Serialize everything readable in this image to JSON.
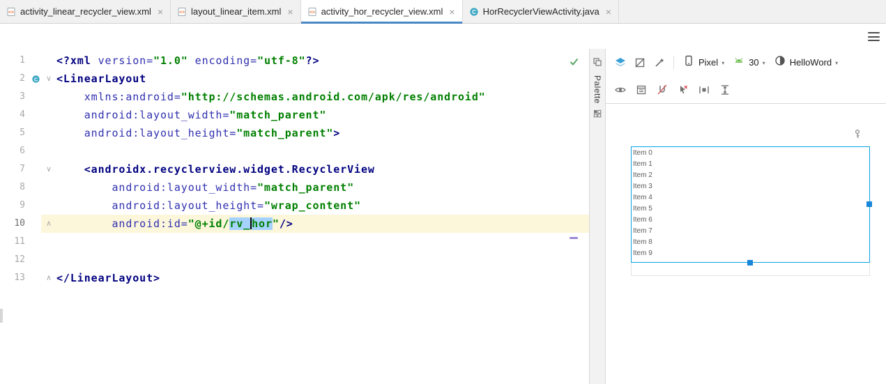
{
  "colors": {
    "tab_underline": "#4A88C5",
    "tag": "#000080",
    "attribute": "#3030B0",
    "value": "#008000",
    "current_line_bg": "#FCF6DB",
    "selection_bg": "#A6D2FF",
    "selection_border": "#0BA1E2",
    "handle": "#1887D9",
    "check_green": "#59A869",
    "android_green": "#77C157",
    "design_icon_blue": "#389FD6"
  },
  "tab_bar": {
    "tabs": [
      {
        "label": "activity_linear_recycler_view.xml",
        "icon": "xml-file-icon",
        "active": false,
        "close": "×"
      },
      {
        "label": "layout_linear_item.xml",
        "icon": "xml-file-icon",
        "active": false,
        "close": "×"
      },
      {
        "label": "activity_hor_recycler_view.xml",
        "icon": "xml-file-icon",
        "active": true,
        "close": "×"
      },
      {
        "label": "HorRecyclerViewActivity.java",
        "icon": "java-class-icon",
        "active": false,
        "close": "×"
      }
    ]
  },
  "navbar": {
    "menu_icon": "hamburger-menu-icon"
  },
  "editor": {
    "inspection_icon": "inspections-ok-icon",
    "lines": [
      {
        "num": 1,
        "fold": "",
        "gutter": "",
        "current": false,
        "tokens": [
          [
            "tag",
            "<?xml "
          ],
          [
            "attr",
            "version="
          ],
          [
            "str",
            "\"1.0\""
          ],
          [
            "plain",
            " "
          ],
          [
            "attr",
            "encoding="
          ],
          [
            "str",
            "\"utf-8\""
          ],
          [
            "tag",
            "?>"
          ]
        ]
      },
      {
        "num": 2,
        "fold": "down",
        "gutter": "class-circle-icon",
        "current": false,
        "tokens": [
          [
            "tag",
            "<LinearLayout"
          ]
        ]
      },
      {
        "num": 3,
        "fold": "",
        "gutter": "",
        "current": false,
        "tokens": [
          [
            "plain",
            "    "
          ],
          [
            "attr",
            "xmlns:android="
          ],
          [
            "str",
            "\"http://schemas.android.com/apk/res/android\""
          ]
        ]
      },
      {
        "num": 4,
        "fold": "",
        "gutter": "",
        "current": false,
        "tokens": [
          [
            "plain",
            "    "
          ],
          [
            "attr",
            "android:layout_width="
          ],
          [
            "str",
            "\"match_parent\""
          ]
        ]
      },
      {
        "num": 5,
        "fold": "",
        "gutter": "",
        "current": false,
        "tokens": [
          [
            "plain",
            "    "
          ],
          [
            "attr",
            "android:layout_height="
          ],
          [
            "str",
            "\"match_parent\""
          ],
          [
            "tag",
            ">"
          ]
        ]
      },
      {
        "num": 6,
        "fold": "",
        "gutter": "",
        "current": false,
        "tokens": []
      },
      {
        "num": 7,
        "fold": "down",
        "gutter": "",
        "current": false,
        "tokens": [
          [
            "plain",
            "    "
          ],
          [
            "tag",
            "<androidx.recyclerview.widget.RecyclerView"
          ]
        ]
      },
      {
        "num": 8,
        "fold": "",
        "gutter": "",
        "current": false,
        "tokens": [
          [
            "plain",
            "        "
          ],
          [
            "attr",
            "android:layout_width="
          ],
          [
            "str",
            "\"match_parent\""
          ]
        ]
      },
      {
        "num": 9,
        "fold": "",
        "gutter": "",
        "current": false,
        "tokens": [
          [
            "plain",
            "        "
          ],
          [
            "attr",
            "android:layout_height="
          ],
          [
            "str",
            "\"wrap_content\""
          ]
        ]
      },
      {
        "num": 10,
        "fold": "up",
        "gutter": "",
        "current": true,
        "tokens": [
          [
            "plain",
            "        "
          ],
          [
            "attr",
            "android:id="
          ],
          [
            "str",
            "\"@+id/"
          ],
          [
            "sel",
            "rv_"
          ],
          [
            "caret",
            ""
          ],
          [
            "sel",
            "hor"
          ],
          [
            "str",
            "\""
          ],
          [
            "tag",
            "/>"
          ]
        ]
      },
      {
        "num": 11,
        "fold": "",
        "gutter": "",
        "current": false,
        "tokens": []
      },
      {
        "num": 12,
        "fold": "",
        "gutter": "",
        "current": false,
        "tokens": []
      },
      {
        "num": 13,
        "fold": "up",
        "gutter": "",
        "current": false,
        "tokens": [
          [
            "tag",
            "</LinearLayout>"
          ]
        ]
      }
    ]
  },
  "palette": {
    "label": "Palette",
    "top_icon": "layers-icon",
    "bottom_icon": "grid-icon"
  },
  "design_toolbar": {
    "row1_icons": [
      "design-surface-icon",
      "blueprint-off-icon",
      "render-options-icon"
    ],
    "device": {
      "icon": "phone-icon",
      "label": "Pixel"
    },
    "api": {
      "icon": "android-icon",
      "label": "30"
    },
    "theme": {
      "icon": "theme-icon",
      "label": "HelloWord"
    },
    "row2_icons": [
      "view-options-icon",
      "system-ui-icon",
      "autoconnect-off-icon",
      "clear-constraints-icon",
      "pack-horizontal-icon",
      "expand-vertical-icon"
    ]
  },
  "preview": {
    "key_icon": "key-icon",
    "items": [
      "Item 0",
      "Item 1",
      "Item 2",
      "Item 3",
      "Item 4",
      "Item 5",
      "Item 6",
      "Item 7",
      "Item 8",
      "Item 9"
    ],
    "selected_view": "RecyclerView"
  }
}
